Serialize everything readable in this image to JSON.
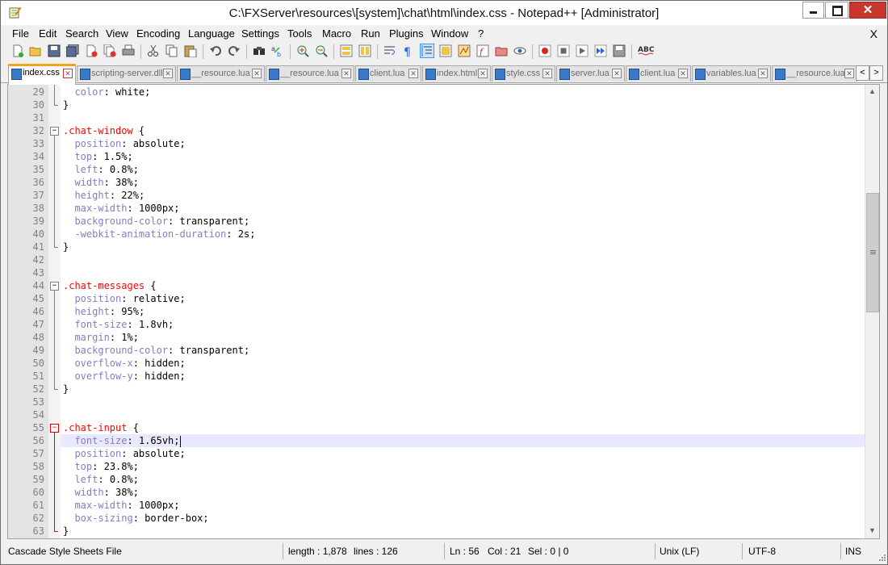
{
  "window": {
    "title": "C:\\FXServer\\resources\\[system]\\chat\\html\\index.css - Notepad++ [Administrator]",
    "close_glyph": "✕"
  },
  "menu": {
    "items": [
      "File",
      "Edit",
      "Search",
      "View",
      "Encoding",
      "Language",
      "Settings",
      "Tools",
      "Macro",
      "Run",
      "Plugins",
      "Window",
      "?"
    ],
    "close_glyph": "X"
  },
  "toolbar": {
    "icons": [
      "new-file-icon",
      "open-file-icon",
      "save-icon",
      "save-all-icon",
      "close-icon",
      "close-all-icon",
      "print-icon",
      "cut-icon",
      "copy-icon",
      "paste-icon",
      "undo-icon",
      "redo-icon",
      "find-icon",
      "replace-icon",
      "zoom-in-icon",
      "zoom-out-icon",
      "sync-vertical-icon",
      "sync-horizontal-icon",
      "word-wrap-icon",
      "show-all-chars-icon",
      "indent-guide-icon",
      "user-defined-language-icon",
      "document-map-icon",
      "function-list-icon",
      "folder-as-workspace-icon",
      "monitoring-icon",
      "record-macro-icon",
      "stop-record-icon",
      "playback-macro-icon",
      "run-macro-multiple-icon",
      "save-macro-icon",
      "spell-check-icon"
    ],
    "spellcheck_label": "ABC"
  },
  "tabs": [
    {
      "label": "index.css",
      "active": true
    },
    {
      "label": "scripting-server.dll",
      "active": false
    },
    {
      "label": "__resource.lua",
      "active": false
    },
    {
      "label": "__resource.lua",
      "active": false
    },
    {
      "label": "client.lua",
      "active": false
    },
    {
      "label": "index.html",
      "active": false
    },
    {
      "label": "style.css",
      "active": false
    },
    {
      "label": "server.lua",
      "active": false
    },
    {
      "label": "client.lua",
      "active": false
    },
    {
      "label": "variables.lua",
      "active": false
    },
    {
      "label": "__resource.lua",
      "active": false
    }
  ],
  "tab_nav": {
    "prev": "<",
    "next": ">"
  },
  "editor": {
    "current_line": 56,
    "lines": [
      {
        "n": "29",
        "indent": "  ",
        "prop": "color",
        "val": "white;"
      },
      {
        "n": "30",
        "text": "}"
      },
      {
        "n": "31",
        "text": ""
      },
      {
        "n": "32",
        "selector": ".chat-window",
        "rest": " {"
      },
      {
        "n": "33",
        "indent": "  ",
        "prop": "position",
        "val": "absolute;"
      },
      {
        "n": "34",
        "indent": "  ",
        "prop": "top",
        "val": "1.5%;"
      },
      {
        "n": "35",
        "indent": "  ",
        "prop": "left",
        "val": "0.8%;"
      },
      {
        "n": "36",
        "indent": "  ",
        "prop": "width",
        "val": "38%;"
      },
      {
        "n": "37",
        "indent": "  ",
        "prop": "height",
        "val": "22%;"
      },
      {
        "n": "38",
        "indent": "  ",
        "prop": "max-width",
        "val": "1000px;"
      },
      {
        "n": "39",
        "indent": "  ",
        "prop": "background-color",
        "val": "transparent;"
      },
      {
        "n": "40",
        "indent": "  ",
        "prop": "-webkit-animation-duration",
        "val": "2s;"
      },
      {
        "n": "41",
        "text": "}"
      },
      {
        "n": "42",
        "text": ""
      },
      {
        "n": "43",
        "text": ""
      },
      {
        "n": "44",
        "selector": ".chat-messages",
        "rest": " {"
      },
      {
        "n": "45",
        "indent": "  ",
        "prop": "position",
        "val": "relative;"
      },
      {
        "n": "46",
        "indent": "  ",
        "prop": "height",
        "val": "95%;"
      },
      {
        "n": "47",
        "indent": "  ",
        "prop": "font-size",
        "val": "1.8vh;"
      },
      {
        "n": "48",
        "indent": "  ",
        "prop": "margin",
        "val": "1%;"
      },
      {
        "n": "49",
        "indent": "  ",
        "prop": "background-color",
        "val": "transparent;"
      },
      {
        "n": "50",
        "indent": "  ",
        "prop": "overflow-x",
        "val": "hidden;"
      },
      {
        "n": "51",
        "indent": "  ",
        "prop": "overflow-y",
        "val": "hidden;"
      },
      {
        "n": "52",
        "text": "}"
      },
      {
        "n": "53",
        "text": ""
      },
      {
        "n": "54",
        "text": ""
      },
      {
        "n": "55",
        "selector": ".chat-input",
        "rest": " {"
      },
      {
        "n": "56",
        "indent": "  ",
        "prop": "font-size",
        "val": "1.65vh;"
      },
      {
        "n": "57",
        "indent": "  ",
        "prop": "position",
        "val": "absolute;"
      },
      {
        "n": "58",
        "indent": "  ",
        "prop": "top",
        "val": "23.8%;"
      },
      {
        "n": "59",
        "indent": "  ",
        "prop": "left",
        "val": "0.8%;"
      },
      {
        "n": "60",
        "indent": "  ",
        "prop": "width",
        "val": "38%;"
      },
      {
        "n": "61",
        "indent": "  ",
        "prop": "max-width",
        "val": "1000px;"
      },
      {
        "n": "62",
        "indent": "  ",
        "prop": "box-sizing",
        "val": "border-box;"
      },
      {
        "n": "63",
        "text": "}"
      }
    ]
  },
  "scrollbar": {
    "up": "▲",
    "down": "▼"
  },
  "status": {
    "file_type": "Cascade Style Sheets File",
    "length": "length : 1,878",
    "lines": "lines : 126",
    "ln": "Ln : 56",
    "col": "Col : 21",
    "sel": "Sel : 0 | 0",
    "eol": "Unix (LF)",
    "encoding": "UTF-8",
    "mode": "INS"
  },
  "colors": {
    "selector": "#ff0000",
    "property": "#8080c0",
    "value": "#000000",
    "current_line_bg": "#e8e8ff",
    "active_tab_accent": "#f5a21c"
  }
}
